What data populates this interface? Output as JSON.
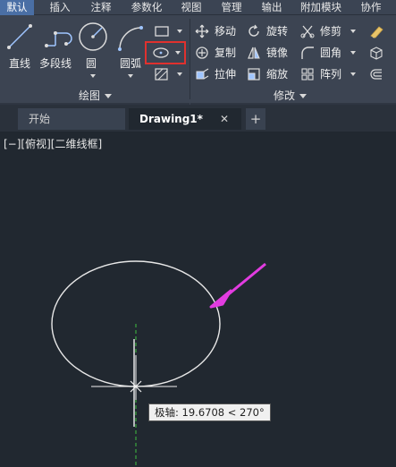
{
  "ribbon_tabs": [
    "默认",
    "插入",
    "注释",
    "参数化",
    "视图",
    "管理",
    "输出",
    "附加模块",
    "协作"
  ],
  "active_tab": "默认",
  "draw_panel": {
    "title": "绘图",
    "tools": {
      "line": "直线",
      "polyline": "多段线",
      "circle": "圆",
      "arc": "圆弧"
    }
  },
  "modify_panel": {
    "title": "修改",
    "tools": {
      "move": "移动",
      "rotate": "旋转",
      "trim": "修剪",
      "copy": "复制",
      "mirror": "镜像",
      "fillet": "圆角",
      "stretch": "拉伸",
      "scale": "缩放",
      "array": "阵列"
    }
  },
  "doc_tabs": {
    "start": "开始",
    "drawing": "Drawing1*",
    "close": "✕",
    "new": "+"
  },
  "viewport_label": "[−][俯视][二维线框]",
  "tooltip": "极轴: 19.6708 < 270°",
  "colors": {
    "highlight": "#e0312e",
    "arrow": "#e23ce0",
    "accent_tab": "#4a6fa5",
    "snap_line": "#3fbf3f"
  }
}
